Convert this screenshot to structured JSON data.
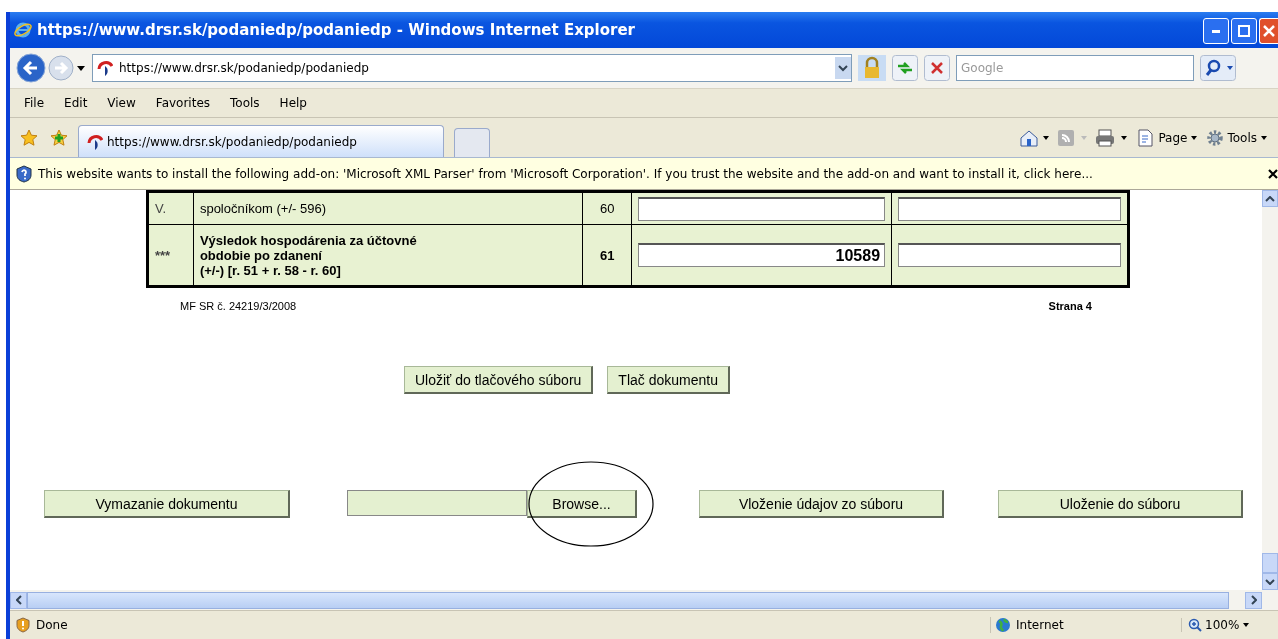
{
  "window": {
    "title": "https://www.drsr.sk/podaniedp/podaniedp - Windows Internet Explorer"
  },
  "address_bar": {
    "url": "https://www.drsr.sk/podaniedp/podaniedp",
    "search_placeholder": "Google"
  },
  "menu": [
    "File",
    "Edit",
    "View",
    "Favorites",
    "Tools",
    "Help"
  ],
  "tabs": [
    {
      "label": "https://www.drsr.sk/podaniedp/podaniedp",
      "selected": true
    }
  ],
  "command_bar": [
    "Page",
    "Tools"
  ],
  "info_bar": {
    "text": "This website wants to install the following add-on: 'Microsoft XML Parser' from 'Microsoft Corporation'. If you trust the website and the add-on and want to install it, click here..."
  },
  "form_table": {
    "rows": [
      {
        "marker": "V.",
        "label_lines": [
          "spoločníkom (+/- 596)"
        ],
        "number": "60",
        "value_1": "",
        "value_2": "",
        "bold": false
      },
      {
        "marker": "***",
        "label_lines": [
          "Výsledok hospodárenia za účtovné",
          "obdobie po zdanení",
          "(+/-) [r. 51 + r. 58 - r. 60]"
        ],
        "number": "61",
        "value_1": "10589",
        "value_2": "",
        "bold": true
      }
    ]
  },
  "page_footer": {
    "form_code": "MF SR č. 24219/3/2008",
    "page_label": "Strana 4"
  },
  "print_buttons": [
    "Uložiť do tlačového súboru",
    "Tlač dokumentu"
  ],
  "file_actions": {
    "delete_button": "Vymazanie dokumentu",
    "browse_button": "Browse...",
    "load_button": "Vloženie údajov zo súboru",
    "save_button": "Uloženie do súboru"
  },
  "status_bar": {
    "text": "Done",
    "zone": "Internet",
    "zoom": "100%"
  }
}
